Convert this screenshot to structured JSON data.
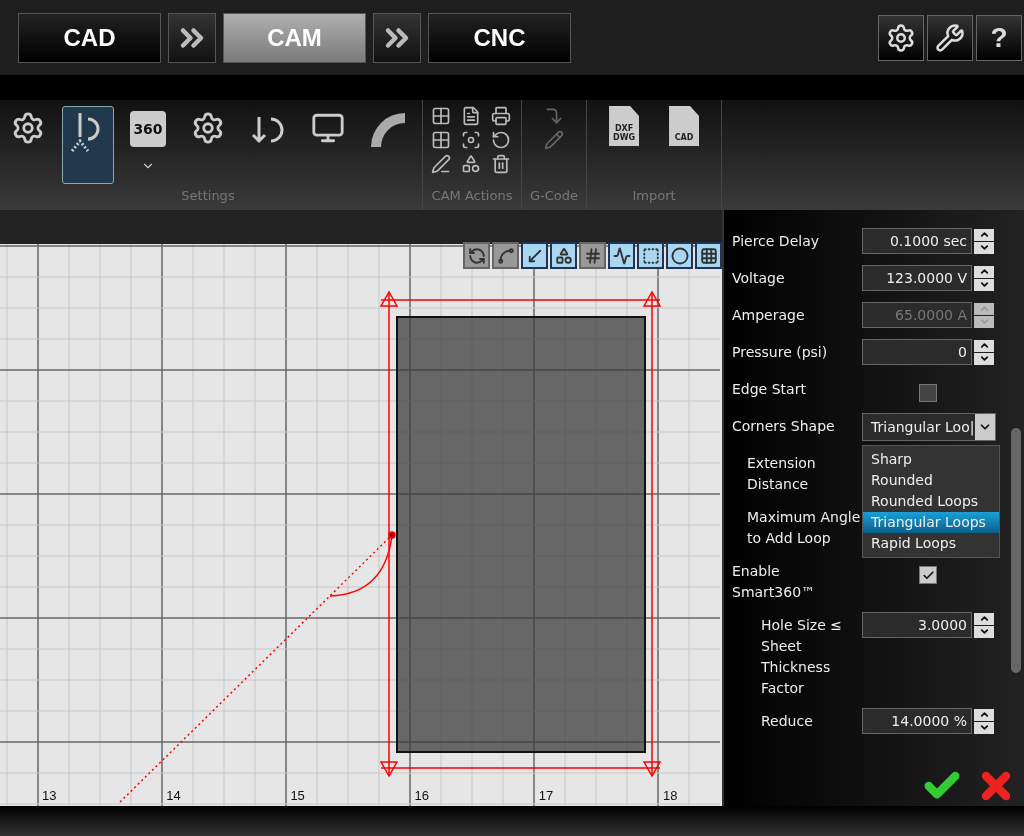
{
  "help_label": "?",
  "top_tabs": [
    {
      "label": "CAD",
      "selected": false
    },
    {
      "label": "CAM",
      "selected": true
    },
    {
      "label": "CNC",
      "selected": false
    }
  ],
  "ribbon": {
    "settings_tools": [
      {
        "kind": "gear",
        "selected": false
      },
      {
        "kind": "torch",
        "selected": true
      },
      {
        "kind": "badge",
        "text": "360",
        "selected": false
      },
      {
        "kind": "m-gear",
        "selected": false
      },
      {
        "kind": "down-gear",
        "selected": false
      },
      {
        "kind": "screen",
        "selected": false
      },
      {
        "kind": "arc",
        "selected": false
      }
    ],
    "groups": [
      {
        "label": "Settings"
      },
      {
        "label": "CAM Actions"
      },
      {
        "label": "G-Code"
      },
      {
        "label": "Import"
      }
    ],
    "import_files": [
      "DXF\nDWG",
      "CAD"
    ]
  },
  "canvas": {
    "toolbar": [
      {
        "selected": false
      },
      {
        "selected": false
      },
      {
        "selected": true
      },
      {
        "selected": true
      },
      {
        "selected": false
      },
      {
        "selected": true
      },
      {
        "selected": true
      },
      {
        "selected": true
      },
      {
        "selected": true
      }
    ],
    "axis_labels": [
      "13",
      "14",
      "15",
      "16",
      "17",
      "18"
    ]
  },
  "properties": [
    {
      "kind": "spinner",
      "label": "Pierce Delay",
      "value": "0.1000 sec",
      "disabled": false
    },
    {
      "kind": "spinner",
      "label": "Voltage",
      "value": "123.0000 V",
      "disabled": false
    },
    {
      "kind": "spinner",
      "label": "Amperage",
      "value": "65.0000 A",
      "disabled": true
    },
    {
      "kind": "spinner",
      "label": "Pressure (psi)",
      "value": "0",
      "disabled": false
    },
    {
      "kind": "checkbox",
      "label": "Edge Start",
      "checked": false
    },
    {
      "kind": "dropdown",
      "label": "Corners Shape",
      "value": "Triangular Loo|",
      "expanded": true,
      "options": [
        {
          "label": "Sharp",
          "selected": false
        },
        {
          "label": "Rounded",
          "selected": false
        },
        {
          "label": "Rounded Loops",
          "selected": false
        },
        {
          "label": "Triangular Loops",
          "selected": true
        },
        {
          "label": "Rapid Loops",
          "selected": false
        }
      ],
      "children": [
        {
          "kind": "label",
          "label": "Extension Distance"
        },
        {
          "kind": "label",
          "label": "Maximum Angle to Add Loop"
        }
      ]
    },
    {
      "kind": "checkbox",
      "label": "Enable Smart360™",
      "checked": true,
      "children": [
        {
          "kind": "spinner",
          "label": "Hole Size ≤ Sheet Thickness Factor",
          "value": "3.0000",
          "disabled": false
        },
        {
          "kind": "spinner",
          "label": "Reduce",
          "value": "14.0000 %",
          "disabled": false
        }
      ]
    }
  ]
}
